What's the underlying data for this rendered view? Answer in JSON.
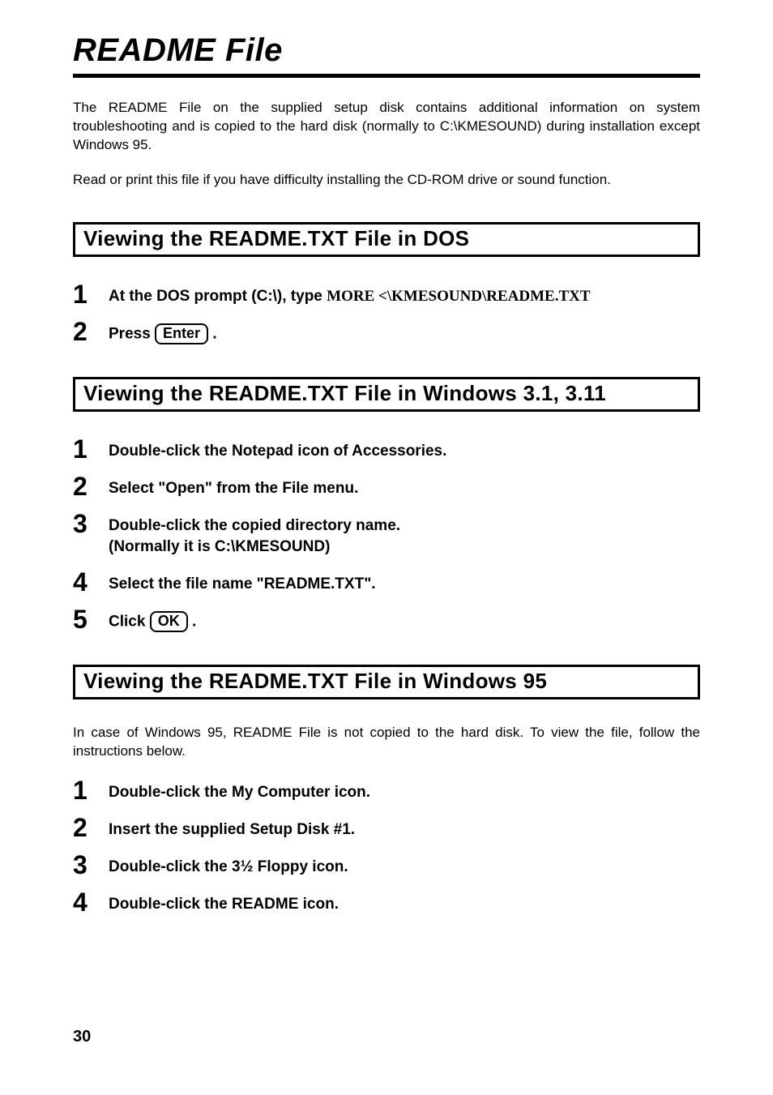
{
  "title": "README File",
  "intro1": "The README File on the supplied setup disk contains additional information on system troubleshooting and is copied to the hard disk (normally to C:\\KMESOUND) during installation except Windows 95.",
  "intro2": "Read or print this file if you have difficulty installing the CD-ROM drive or sound function.",
  "sectionDos": {
    "heading": "Viewing the README.TXT File in DOS",
    "steps": {
      "s1num": "1",
      "s1a": "At the DOS prompt (C:\\), type ",
      "s1b": "MORE <\\KMESOUND\\README.TXT",
      "s2num": "2",
      "s2a": "Press ",
      "s2key": "Enter",
      "s2b": " ."
    }
  },
  "sectionWin31": {
    "heading": "Viewing the README.TXT File in Windows 3.1, 3.11",
    "steps": {
      "s1num": "1",
      "s1": "Double-click the Notepad icon of Accessories.",
      "s2num": "2",
      "s2": "Select \"Open\" from the File menu.",
      "s3num": "3",
      "s3a": "Double-click the copied directory name.",
      "s3b": "(Normally it is C:\\KMESOUND)",
      "s4num": "4",
      "s4": "Select the file name \"README.TXT\".",
      "s5num": "5",
      "s5a": "Click ",
      "s5key": "OK",
      "s5b": " ."
    }
  },
  "sectionWin95": {
    "heading": "Viewing the README.TXT File in Windows 95",
    "intro": "In case of Windows 95, README File is not copied to the hard disk. To view the file, follow the instructions below.",
    "steps": {
      "s1num": "1",
      "s1": "Double-click the My Computer icon.",
      "s2num": "2",
      "s2": "Insert the supplied Setup Disk #1.",
      "s3num": "3",
      "s3a": "Double-click the 3",
      "s3half": "½",
      "s3b": " Floppy icon.",
      "s4num": "4",
      "s4": "Double-click the README icon."
    }
  },
  "pageNumber": "30"
}
